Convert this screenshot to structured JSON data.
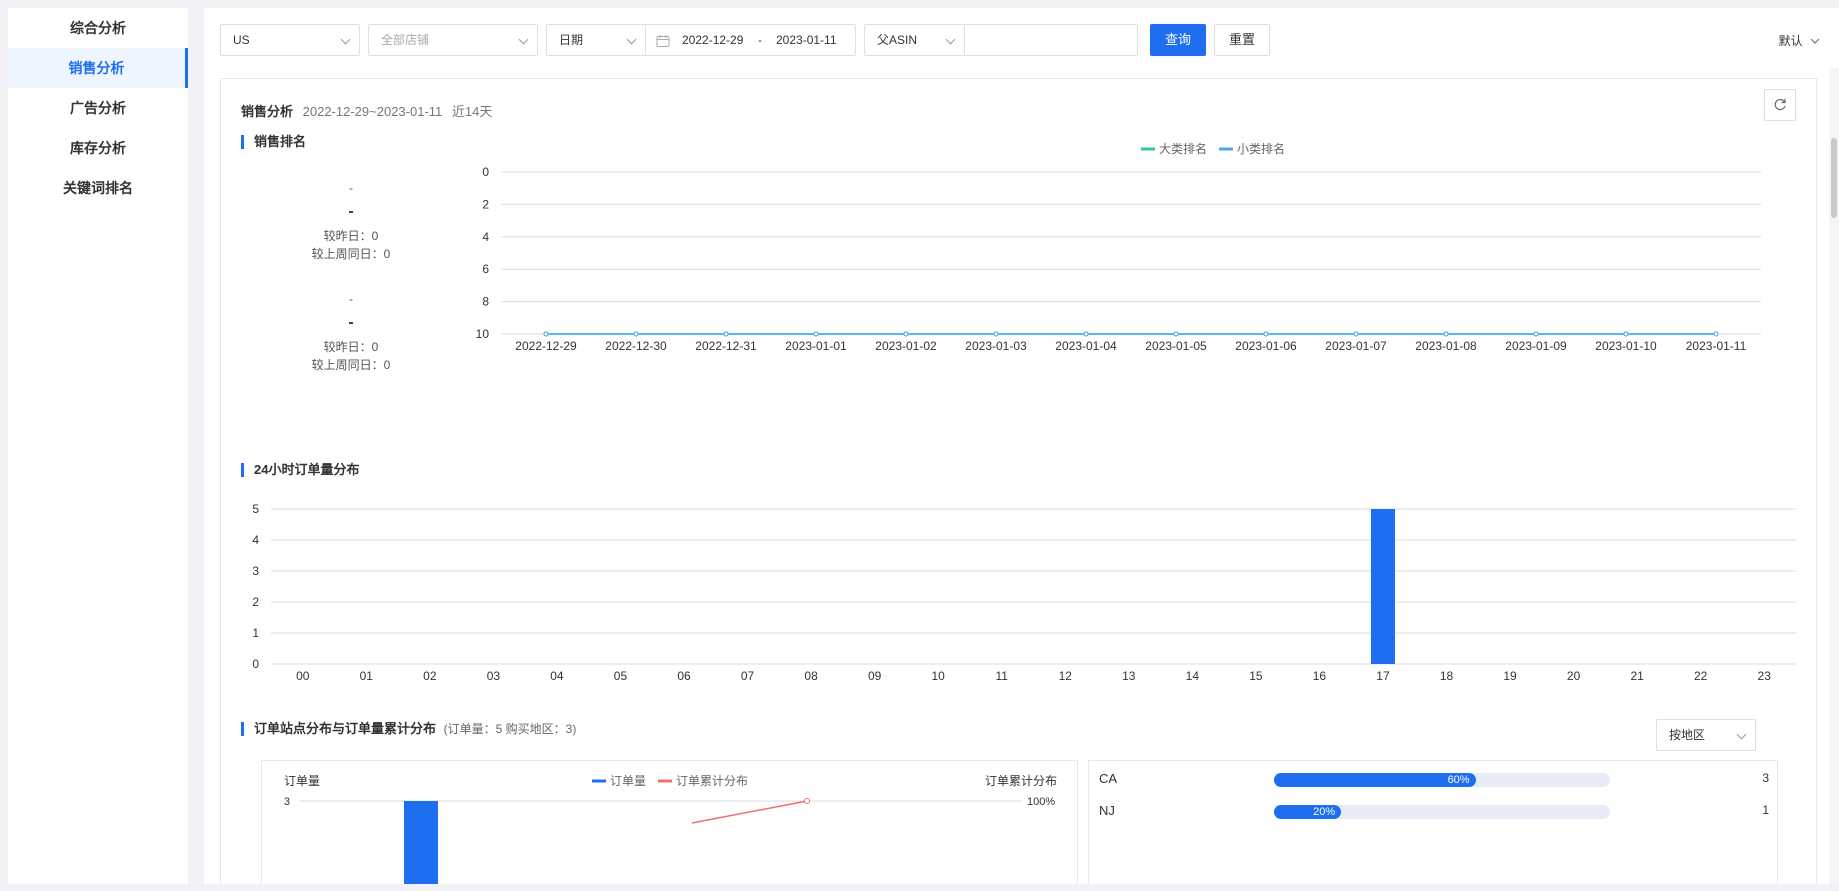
{
  "sidebar": {
    "items": [
      {
        "label": "综合分析"
      },
      {
        "label": "销售分析"
      },
      {
        "label": "广告分析"
      },
      {
        "label": "库存分析"
      },
      {
        "label": "关键词排名"
      }
    ],
    "active_index": 1
  },
  "filters": {
    "marketplace": "US",
    "store_placeholder": "全部店铺",
    "date_type": "日期",
    "date_start": "2022-12-29",
    "date_sep": "-",
    "date_end": "2023-01-11",
    "asin_type": "父ASIN",
    "asin_value": "",
    "query_label": "查询",
    "reset_label": "重置",
    "default_label": "默认"
  },
  "panel": {
    "title": "销售分析",
    "range": "2022-12-29~2023-01-11",
    "period": "近14天"
  },
  "rank_section": {
    "title": "销售排名",
    "stats": [
      {
        "name": "-",
        "value": "-",
        "vs_yesterday": "较昨日：0",
        "vs_last_week": "较上周同日：0"
      },
      {
        "name": "-",
        "value": "-",
        "vs_yesterday": "较昨日：0",
        "vs_last_week": "较上周同日：0"
      }
    ]
  },
  "hourly_section": {
    "title": "24小时订单量分布"
  },
  "site_section": {
    "title": "订单站点分布与订单量累计分布",
    "summary": "(订单量：5  购买地区：3)",
    "group_by": "按地区",
    "regions": [
      {
        "name": "CA",
        "percent_label": "60%",
        "count": "3",
        "fraction": 0.6
      },
      {
        "name": "NJ",
        "percent_label": "20%",
        "count": "1",
        "fraction": 0.2
      }
    ]
  },
  "chart_data": [
    {
      "type": "line",
      "title": "销售排名",
      "categories": [
        "2022-12-29",
        "2022-12-30",
        "2022-12-31",
        "2023-01-01",
        "2023-01-02",
        "2023-01-03",
        "2023-01-04",
        "2023-01-05",
        "2023-01-06",
        "2023-01-07",
        "2023-01-08",
        "2023-01-09",
        "2023-01-10",
        "2023-01-11"
      ],
      "series": [
        {
          "name": "大类排名",
          "color": "#2ec7a0",
          "values": [
            10,
            10,
            10,
            10,
            10,
            10,
            10,
            10,
            10,
            10,
            10,
            10,
            10,
            10
          ]
        },
        {
          "name": "小类排名",
          "color": "#4da6ef",
          "values": [
            10,
            10,
            10,
            10,
            10,
            10,
            10,
            10,
            10,
            10,
            10,
            10,
            10,
            10
          ]
        }
      ],
      "y_ticks": [
        0,
        2,
        4,
        6,
        8,
        10
      ],
      "ylim": [
        0,
        10
      ],
      "y_inverted": true,
      "legend": "top-center",
      "grid": true
    },
    {
      "type": "bar",
      "title": "24小时订单量分布",
      "categories": [
        "00",
        "01",
        "02",
        "03",
        "04",
        "05",
        "06",
        "07",
        "08",
        "09",
        "10",
        "11",
        "12",
        "13",
        "14",
        "15",
        "16",
        "17",
        "18",
        "19",
        "20",
        "21",
        "22",
        "23"
      ],
      "values": [
        0,
        0,
        0,
        0,
        0,
        0,
        0,
        0,
        0,
        0,
        0,
        0,
        0,
        0,
        0,
        0,
        0,
        5,
        0,
        0,
        0,
        0,
        0,
        0
      ],
      "color": "#1e6ef0",
      "y_ticks": [
        0,
        1,
        2,
        3,
        4,
        5
      ],
      "ylim": [
        0,
        5
      ],
      "grid": true
    },
    {
      "type": "bar",
      "title": "",
      "ylabel": "订单量",
      "y2label": "订单累计分布",
      "series": [
        {
          "name": "订单量",
          "color": "#1e6ef0"
        },
        {
          "name": "订单累计分布",
          "color": "#f07070"
        }
      ],
      "y_ticks_visible": [
        "3"
      ],
      "y2_ticks_visible": [
        "100%"
      ],
      "legend": "top-center"
    }
  ]
}
